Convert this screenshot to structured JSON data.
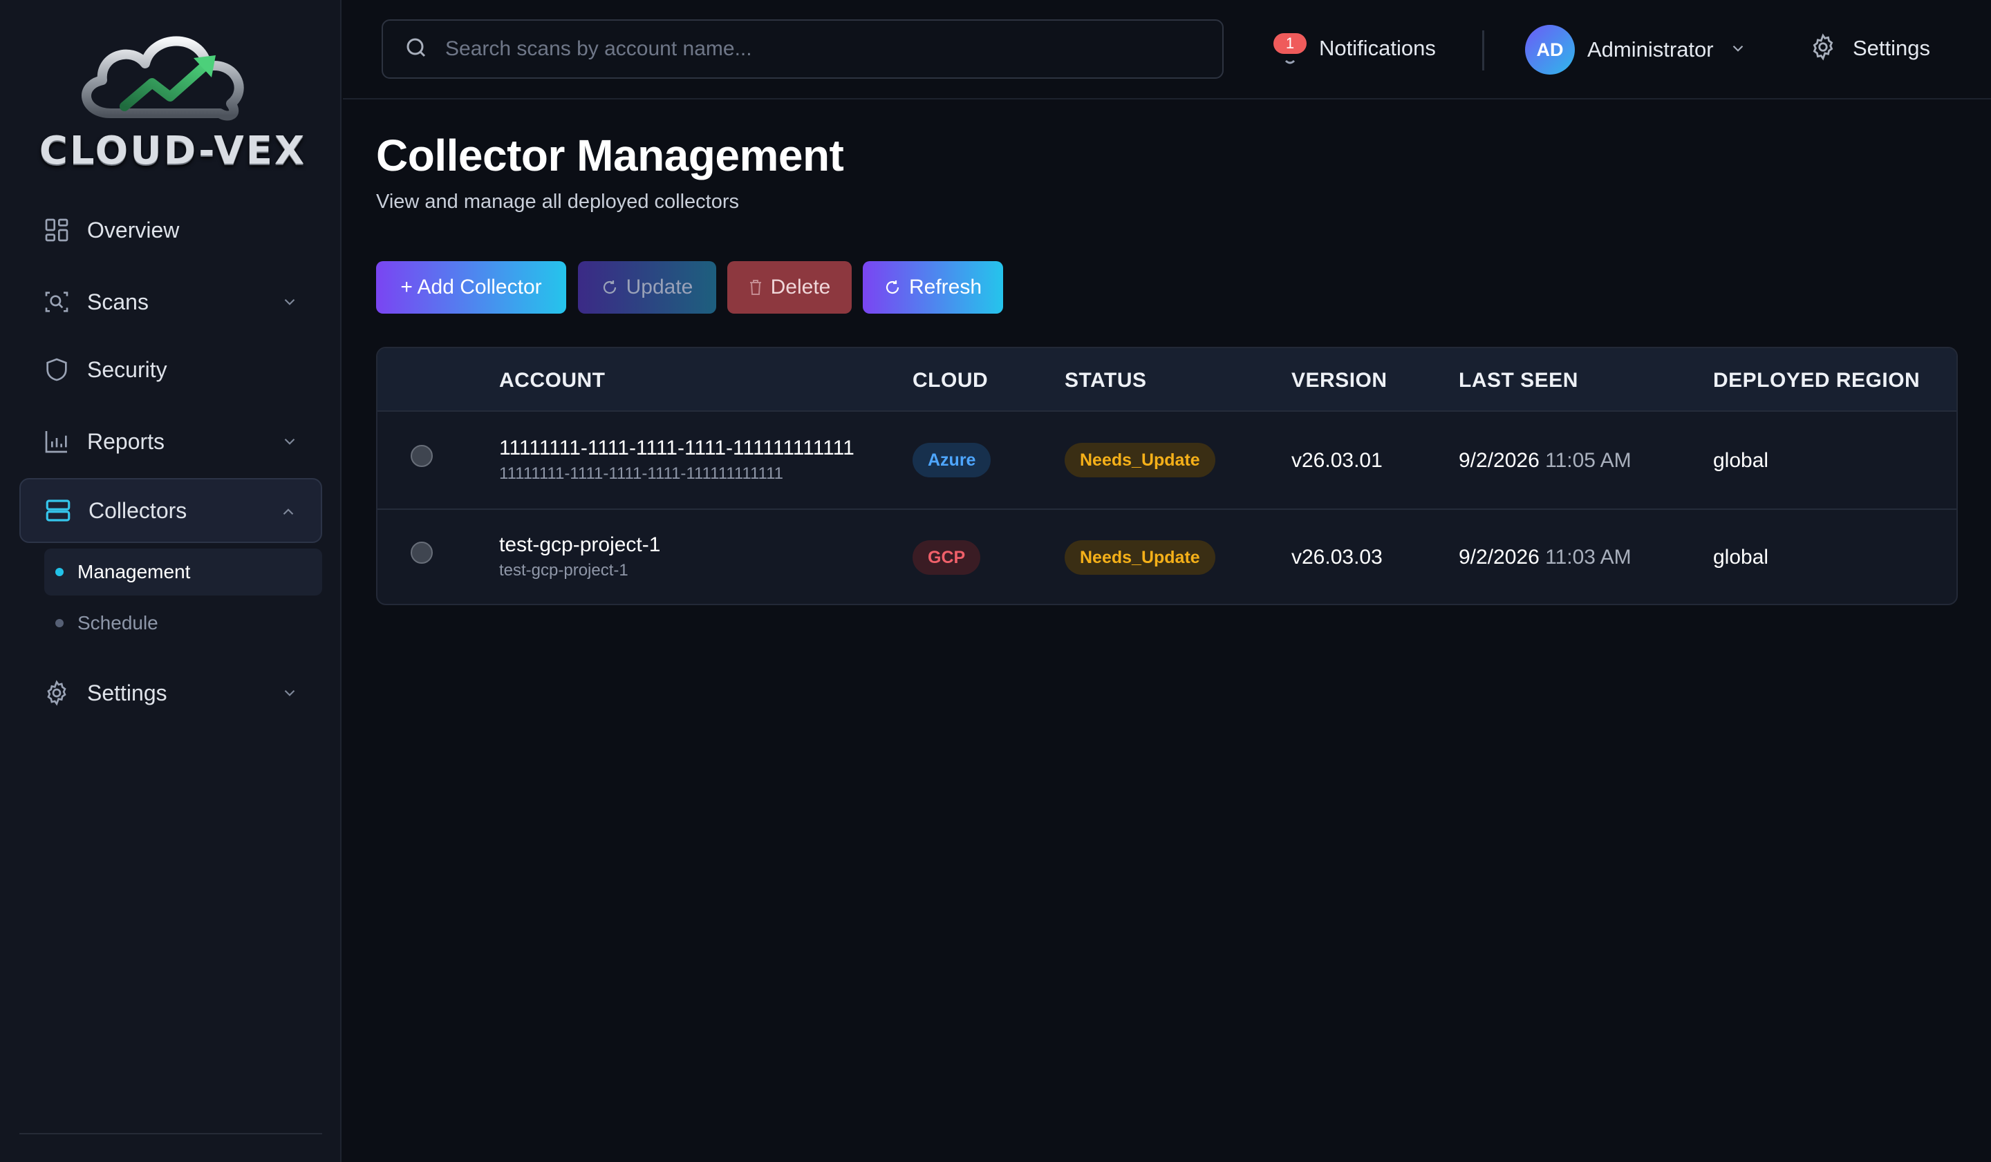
{
  "sidebar": {
    "logo_text": "CLOUD-VEX",
    "nav": [
      {
        "label": "Overview",
        "icon": "grid-icon"
      },
      {
        "label": "Scans",
        "icon": "scan-icon"
      },
      {
        "label": "Security",
        "icon": "shield-icon"
      },
      {
        "label": "Reports",
        "icon": "bar-chart-icon"
      },
      {
        "label": "Collectors",
        "icon": "server-icon"
      },
      {
        "label": "Settings",
        "icon": "gear-icon"
      }
    ],
    "collectors_sub": [
      {
        "label": "Management",
        "active": true
      },
      {
        "label": "Schedule",
        "active": false
      }
    ]
  },
  "header": {
    "search_placeholder": "Search scans by account name...",
    "notifications": {
      "label": "Notifications",
      "count": "1"
    },
    "user": {
      "initials": "AD",
      "name": "Administrator"
    },
    "settings_label": "Settings"
  },
  "main": {
    "title": "Collector Management",
    "subtitle": "View and manage all deployed collectors",
    "buttons": {
      "add": "+ Add Collector",
      "update": "Update",
      "delete": "Delete",
      "refresh": "Refresh"
    },
    "table": {
      "columns": [
        "ACCOUNT",
        "CLOUD",
        "STATUS",
        "VERSION",
        "LAST SEEN",
        "DEPLOYED REGION"
      ],
      "rows": [
        {
          "account": "11111111-1111-1111-1111-111111111111",
          "account_sub": "11111111-1111-1111-1111-111111111111",
          "cloud": "Azure",
          "status": "Needs_Update",
          "version": "v26.03.01",
          "last_seen_date": "9/2/2026",
          "last_seen_time": "11:05 AM",
          "region": "global"
        },
        {
          "account": "test-gcp-project-1",
          "account_sub": "test-gcp-project-1",
          "cloud": "GCP",
          "status": "Needs_Update",
          "version": "v26.03.03",
          "last_seen_date": "9/2/2026",
          "last_seen_time": "11:03 AM",
          "region": "global"
        }
      ]
    }
  },
  "colors": {
    "accent_start": "#7a45f2",
    "accent_end": "#25c4ec",
    "danger": "#8d383f",
    "status_warning": "#f5b019",
    "azure": "#4ea6ff",
    "gcp": "#f0606a"
  }
}
